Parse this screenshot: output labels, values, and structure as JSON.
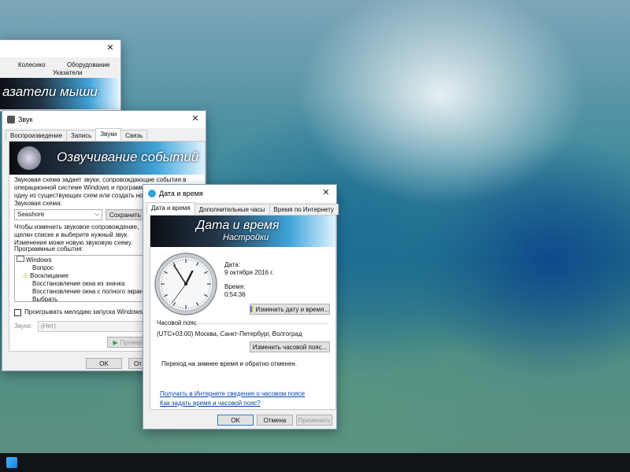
{
  "mouse_window": {
    "tab_wheel": "Колесико",
    "tab_hardware": "Оборудование",
    "tab_pointers": "Указатели",
    "banner": "азатели мыши"
  },
  "sound_window": {
    "title": "Звук",
    "tabs": [
      "Воспроизведение",
      "Запись",
      "Звуки",
      "Связь"
    ],
    "banner": "Озвучивание событий",
    "description": "Звуковая схема задает звуки, сопровождающие события в операционной системе Windows и программах. Можно выбрать одну из существующих схем или создать новую.",
    "scheme_label": "Звуковая схема:",
    "scheme_value": "Seashore",
    "save_button": "Сохранить как",
    "events_hint": "Чтобы изменить звуковое сопровождение, щелкн списке и выберите нужный звук. Изменения може новую звуковую схему.",
    "events_label": "Программные события:",
    "events": [
      "Windows",
      "Вопрос",
      "Восклицание",
      "Восстановление окна из значка",
      "Восстановление окна с полного экрана",
      "Выбрать"
    ],
    "startup_checkbox": "Проигрывать мелодию запуска Windows",
    "sounds_label": "Звуки:",
    "sounds_value": "(Нет)",
    "test_button": "Проверит",
    "ok": "OK",
    "cancel": "От"
  },
  "datetime_window": {
    "title": "Дата и время",
    "tabs": [
      "Дата и время",
      "Дополнительные часы",
      "Время по Интернету"
    ],
    "banner_title": "Дата и время",
    "banner_subtitle": "Настройки",
    "date_label": "Дата:",
    "date_value": "9 октября 2016 г.",
    "time_label": "Время:",
    "time_value": "0:54:36",
    "change_datetime_button": "Изменить дату и время...",
    "timezone_section": "Часовой пояс",
    "timezone_value": "(UTC+03:00) Москва, Санкт-Петербург, Волгоград",
    "change_timezone_button": "Изменить часовой пояс...",
    "dst_note": "Переход на зимнее время и обратно отменен.",
    "link_online": "Получить в Интернете сведения о часовом поясе",
    "link_howto": "Как задать время и часовой пояс?",
    "ok": "OK",
    "cancel": "Отмена",
    "apply": "Применить",
    "clock": {
      "hour": 0,
      "minute": 54,
      "second": 36
    }
  },
  "colors": {
    "accent": "#3fa4d8",
    "link": "#0645ad"
  }
}
